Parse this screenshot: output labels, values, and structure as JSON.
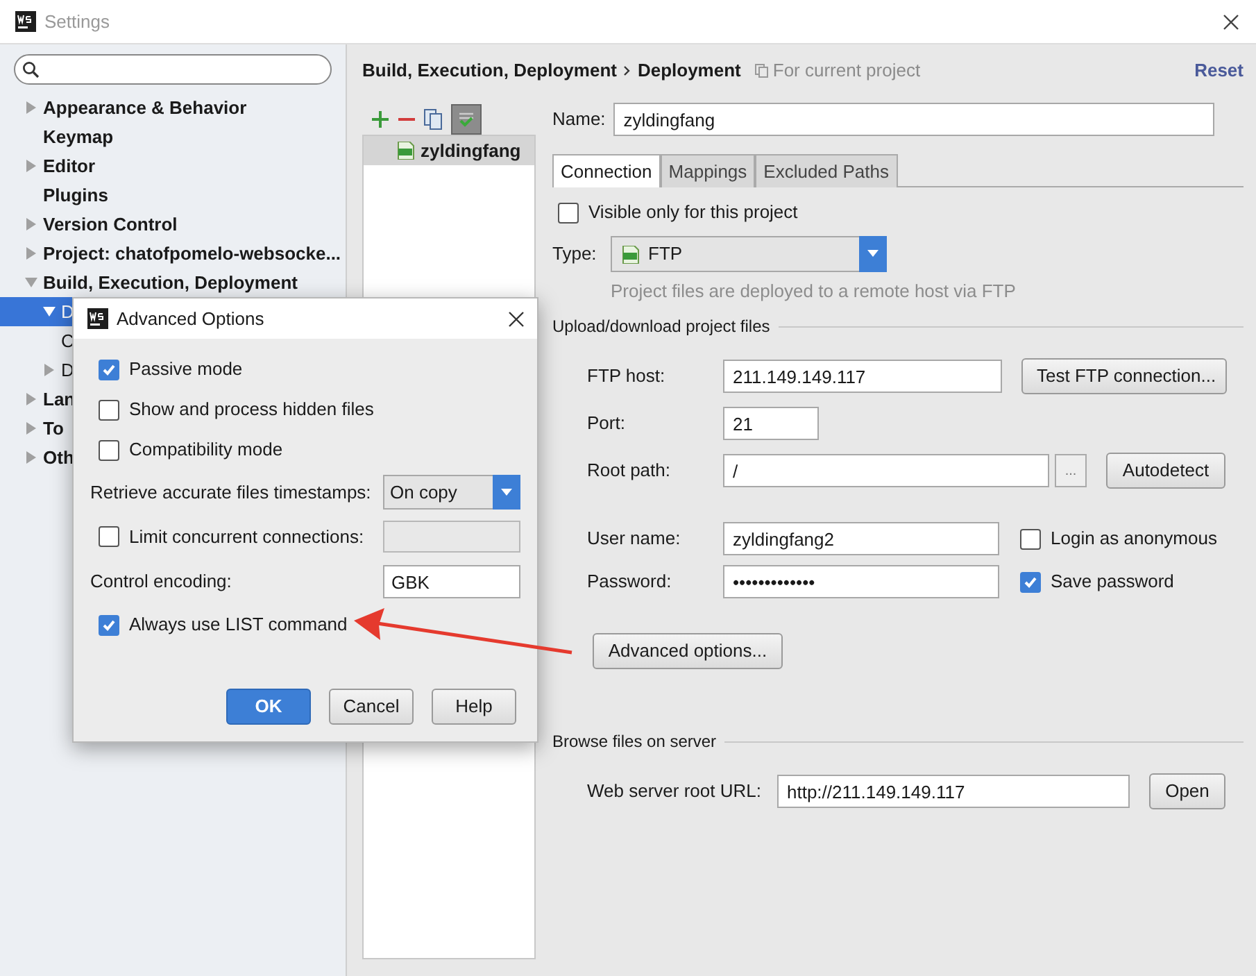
{
  "window": {
    "title": "Settings"
  },
  "sidebar": {
    "items": [
      {
        "label": "Appearance & Behavior",
        "kind": "group",
        "expanded": false,
        "selected": false
      },
      {
        "label": "Keymap",
        "kind": "page",
        "selected": false
      },
      {
        "label": "Editor",
        "kind": "group",
        "expanded": false,
        "selected": false
      },
      {
        "label": "Plugins",
        "kind": "page",
        "selected": false
      },
      {
        "label": "Version Control",
        "kind": "group",
        "expanded": false,
        "selected": false
      },
      {
        "label": "Project: chatofpomelo-websocke...",
        "kind": "group",
        "expanded": false,
        "selected": false
      },
      {
        "label": "Build, Execution, Deployment",
        "kind": "group",
        "expanded": true,
        "selected": false,
        "children": [
          {
            "label": "D",
            "kind": "group",
            "expanded": true,
            "selected": true
          },
          {
            "label": "C",
            "kind": "page",
            "selected": false
          },
          {
            "label": "D",
            "kind": "group",
            "expanded": false,
            "selected": false
          }
        ]
      },
      {
        "label": "Lan",
        "kind": "group",
        "expanded": false,
        "selected": false
      },
      {
        "label": "To",
        "kind": "group",
        "expanded": false,
        "selected": false
      },
      {
        "label": "Oth",
        "kind": "group",
        "expanded": false,
        "selected": false
      }
    ]
  },
  "header": {
    "breadcrumb": [
      "Build, Execution, Deployment",
      "Deployment"
    ],
    "scope": "For current project",
    "reset": "Reset"
  },
  "servers": [
    {
      "label": "zyldingfang",
      "selected": true
    }
  ],
  "form": {
    "name_label": "Name:",
    "name": "zyldingfang",
    "tabs": [
      {
        "label": "Connection",
        "selected": true
      },
      {
        "label": "Mappings",
        "selected": false
      },
      {
        "label": "Excluded Paths",
        "selected": false
      }
    ],
    "visible_only": {
      "label": "Visible only for this project",
      "checked": false
    },
    "type_label": "Type:",
    "type": "FTP",
    "type_hint": "Project files are deployed to a remote host via FTP",
    "upload_section": "Upload/download project files",
    "ftp_host": {
      "label": "FTP host:",
      "value": "211.149.149.117",
      "button": "Test FTP connection..."
    },
    "port": {
      "label": "Port:",
      "value": "21"
    },
    "root_path": {
      "label": "Root path:",
      "value": "/",
      "browse": "...",
      "button": "Autodetect"
    },
    "user_name": {
      "label": "User name:",
      "value": "zyldingfang2",
      "anonymous": {
        "label": "Login as anonymous",
        "checked": false
      }
    },
    "password": {
      "label": "Password:",
      "value": "•••••••••••••",
      "save": {
        "label": "Save password",
        "checked": true
      }
    },
    "advanced_button": "Advanced options...",
    "browse_section": "Browse files on server",
    "web_url": {
      "label": "Web server root URL:",
      "value": "http://211.149.149.117",
      "button": "Open"
    }
  },
  "dialog": {
    "title": "Advanced Options",
    "options": [
      {
        "kind": "checkbox",
        "label": "Passive mode",
        "checked": true
      },
      {
        "kind": "checkbox",
        "label": "Show and process hidden files",
        "checked": false
      },
      {
        "kind": "checkbox",
        "label": "Compatibility mode",
        "checked": false
      },
      {
        "kind": "select",
        "label": "Retrieve accurate files timestamps:",
        "value": "On copy"
      },
      {
        "kind": "checkbox_field",
        "label": "Limit concurrent connections:",
        "checked": false,
        "disabled": true
      },
      {
        "kind": "text",
        "label": "Control encoding:",
        "value": "GBK"
      },
      {
        "kind": "checkbox",
        "label": "Always use LIST command",
        "checked": true
      }
    ],
    "buttons": [
      {
        "label": "OK",
        "default": true
      },
      {
        "label": "Cancel",
        "default": false
      },
      {
        "label": "Help",
        "default": false
      }
    ]
  }
}
